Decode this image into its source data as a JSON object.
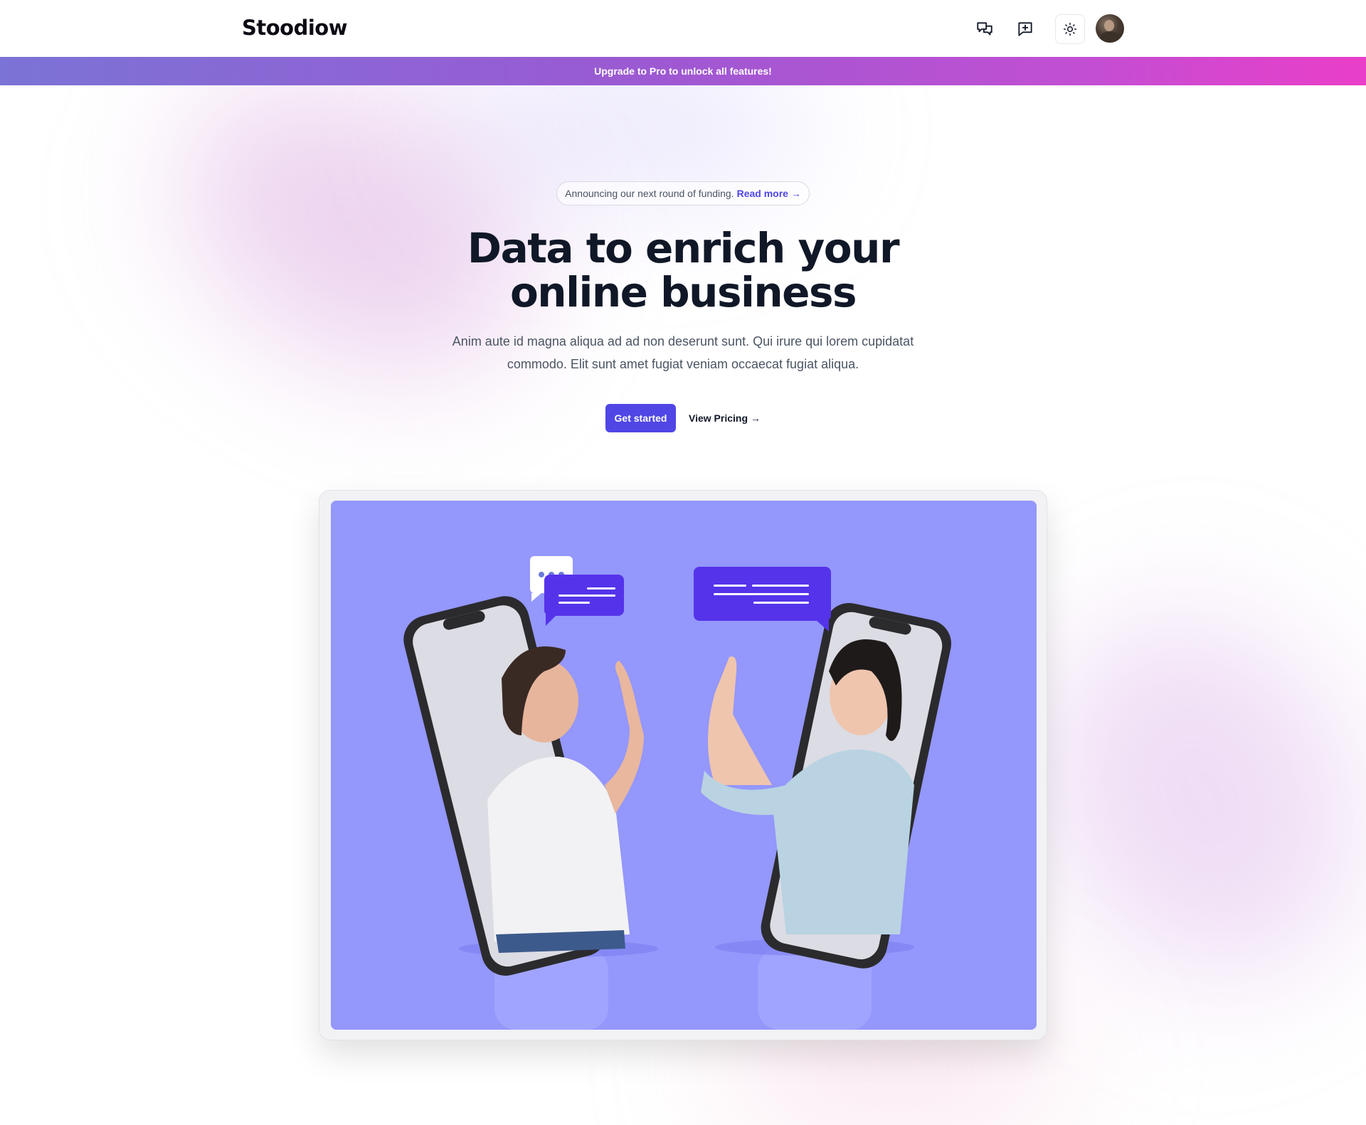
{
  "header": {
    "logo": "Stoodiow",
    "icons": {
      "chat": "chat-bubbles-icon",
      "new_message": "message-plus-icon",
      "theme": "sun-icon",
      "avatar": "user-avatar"
    }
  },
  "banner": {
    "text": "Upgrade to Pro to unlock all features!"
  },
  "hero": {
    "announcement": "Announcing our next round of funding.",
    "announcement_link": "Read more →",
    "headline_line1": "Data to enrich your",
    "headline_line2": "online business",
    "subtext": "Anim aute id magna aliqua ad ad non deserunt sunt. Qui irure qui lorem cupidatat commodo. Elit sunt amet fugiat veniam occaecat fugiat aliqua.",
    "primary_button": "Get started",
    "secondary_button": "View Pricing →"
  },
  "colors": {
    "accent": "#4f46e5",
    "image_background": "#9497fb",
    "banner_start": "#7b73d6",
    "banner_end": "#ea3ec8"
  }
}
